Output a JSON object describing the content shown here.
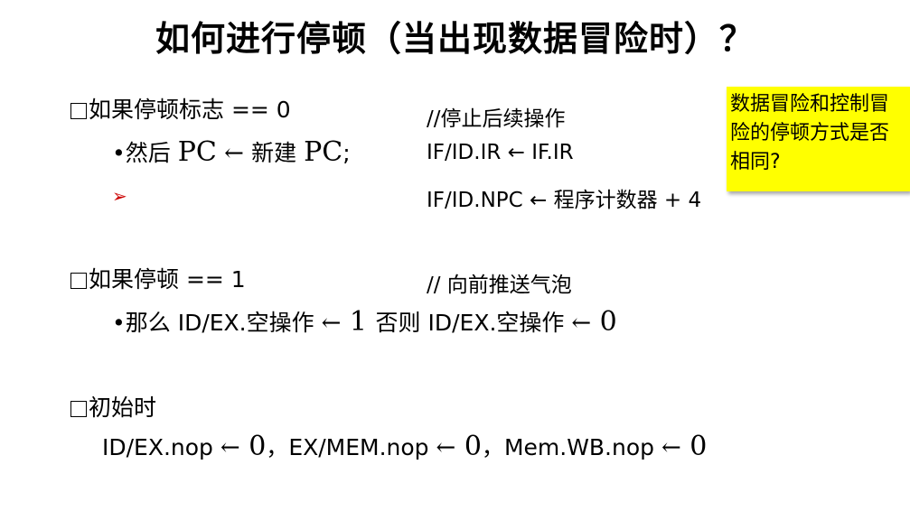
{
  "title": "如何进行停顿（当出现数据冒险时）？",
  "section1": {
    "heading": "如果停顿标志 == 0",
    "comment": "//停止后续操作",
    "line1": {
      "bullet": "•",
      "pre": "然后 ",
      "pc1": "PC",
      "arrow": " ← ",
      "mid": "新建 ",
      "pc2": "PC",
      "post": ";"
    },
    "line1_code": "IF/ID.IR ← IF.IR",
    "line2_bullet": "➢",
    "line2_code": "IF/ID.NPC ← 程序计数器 + 4"
  },
  "section2": {
    "heading": "如果停顿 == 1",
    "comment": "// 向前推送气泡",
    "line": {
      "bullet": "•",
      "a": "那么 ID/EX.空操作 ",
      "arrow1": "←",
      "v1": " 1 ",
      "b": "否则 ID/EX.空操作 ",
      "arrow2": "←",
      "v2": " 0"
    }
  },
  "section3": {
    "heading": "初始时",
    "line": {
      "a": "ID/EX.nop ",
      "arrow1": "←",
      "v1": " 0",
      "sep1": "，",
      "b": "EX/MEM.nop ",
      "arrow2": "←",
      "v2": " 0",
      "sep2": "，",
      "c": "Mem.WB.nop ",
      "arrow3": "←",
      "v3": " 0"
    }
  },
  "note": {
    "text": "数据冒险和控制冒险的停顿方式是否相同?",
    "background": "#ffff00"
  },
  "colors": {
    "bullet_arrow": "#cc0000"
  }
}
